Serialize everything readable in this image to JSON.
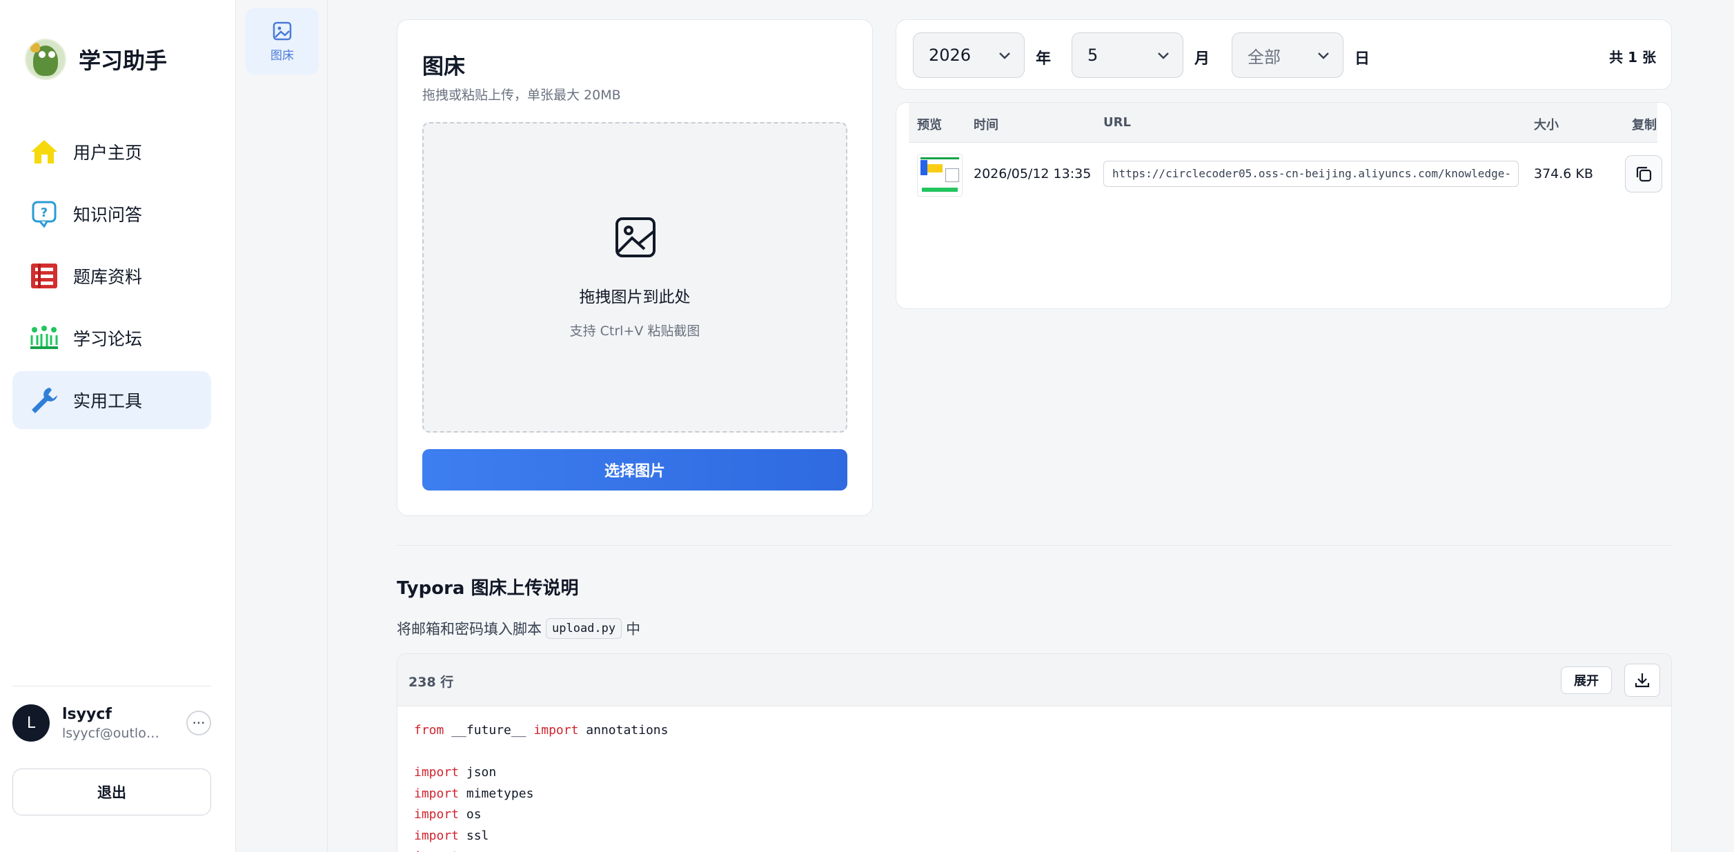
{
  "app": {
    "name": "学习助手"
  },
  "sidebar": {
    "items": [
      {
        "label": "用户主页",
        "icon": "home-icon"
      },
      {
        "label": "知识问答",
        "icon": "question-bubble-icon"
      },
      {
        "label": "题库资料",
        "icon": "question-bank-icon"
      },
      {
        "label": "学习论坛",
        "icon": "forum-icon"
      },
      {
        "label": "实用工具",
        "icon": "wrench-icon",
        "active": true
      }
    ]
  },
  "user": {
    "initial": "L",
    "name": "lsyycf",
    "email": "lsyycf@outlook.com",
    "more": "···",
    "logout_label": "退出"
  },
  "rail": {
    "items": [
      {
        "label": "图床",
        "icon": "image-icon"
      }
    ]
  },
  "upload": {
    "title": "图床",
    "subtitle": "拖拽或粘贴上传，单张最大 20MB",
    "drop_title": "拖拽图片到此处",
    "drop_hint": "支持 Ctrl+V 粘贴截图",
    "choose_label": "选择图片"
  },
  "filter": {
    "year": "2026",
    "year_label": "年",
    "month": "5",
    "month_label": "月",
    "day": "全部",
    "day_label": "日",
    "total": "共 1 张"
  },
  "table": {
    "headers": {
      "preview": "预览",
      "time": "时间",
      "url": "URL",
      "size": "大小",
      "copy": "复制"
    },
    "rows": [
      {
        "time": "2026/05/12 13:35",
        "url": "https://circlecoder05.oss-cn-beijing.aliyuncs.com/knowledge-",
        "size": "374.6 KB"
      }
    ]
  },
  "typora": {
    "title": "Typora 图床上传说明",
    "desc_before": "将邮箱和密码填入脚本",
    "desc_code": "upload.py",
    "desc_after": "中",
    "line_count": "238 行",
    "expand_label": "展开"
  },
  "code": {
    "lines": [
      {
        "kw": "from",
        "rest": " __future__ ",
        "kw2": "import",
        "rest2": " annotations"
      },
      {
        "kw": "",
        "rest": ""
      },
      {
        "kw": "import",
        "rest": " json"
      },
      {
        "kw": "import",
        "rest": " mimetypes"
      },
      {
        "kw": "import",
        "rest": " os"
      },
      {
        "kw": "import",
        "rest": " ssl"
      },
      {
        "kw": "import",
        "rest": ""
      }
    ]
  },
  "colors": {
    "accent": "#3d7ef0",
    "active_bg": "#eaf2fd",
    "keyword": "#d1242f"
  }
}
